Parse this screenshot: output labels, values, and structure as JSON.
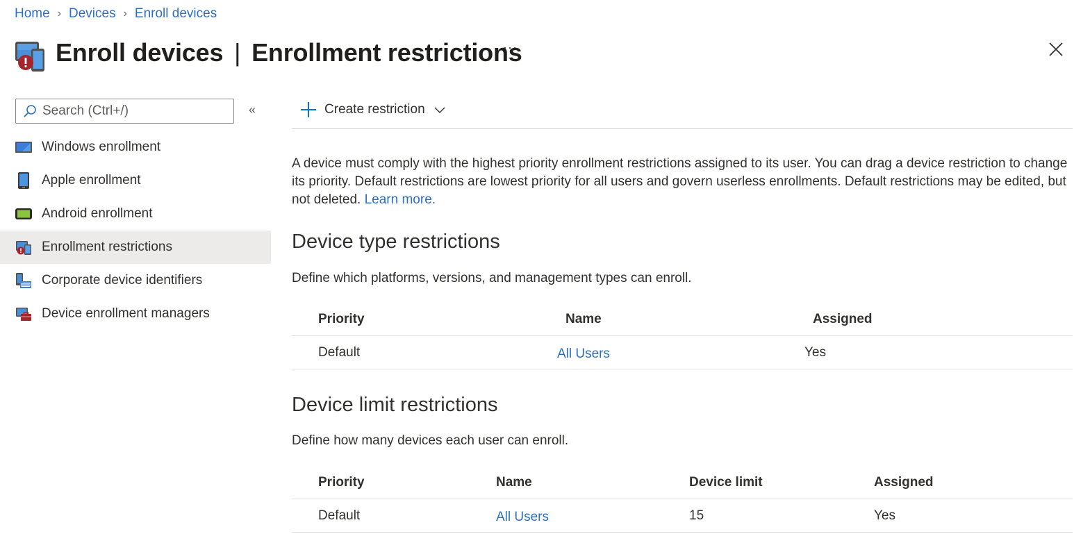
{
  "breadcrumb": [
    {
      "label": "Home"
    },
    {
      "label": "Devices"
    },
    {
      "label": "Enroll devices"
    }
  ],
  "header": {
    "title_main": "Enroll devices",
    "title_sep": "|",
    "title_sub": "Enrollment restrictions",
    "more_label": "···",
    "icon": "enrollment-restrictions-icon"
  },
  "sidebar": {
    "search_placeholder": "Search (Ctrl+/)",
    "collapse_label": "«",
    "items": [
      {
        "label": "Windows enrollment",
        "icon": "windows-device-icon",
        "active": false
      },
      {
        "label": "Apple enrollment",
        "icon": "apple-device-icon",
        "active": false
      },
      {
        "label": "Android enrollment",
        "icon": "android-device-icon",
        "active": false
      },
      {
        "label": "Enrollment restrictions",
        "icon": "restrictions-icon",
        "active": true
      },
      {
        "label": "Corporate device identifiers",
        "icon": "device-identifiers-icon",
        "active": false
      },
      {
        "label": "Device enrollment managers",
        "icon": "enrollment-managers-icon",
        "active": false
      }
    ]
  },
  "toolbar": {
    "create_label": "Create restriction"
  },
  "main": {
    "description": "A device must comply with the highest priority enrollment restrictions assigned to its user. You can drag a device restriction to change its priority. Default restrictions are lowest priority for all users and govern userless enrollments. Default restrictions may be edited, but not deleted.",
    "learn_more": "Learn more.",
    "device_type": {
      "title": "Device type restrictions",
      "subtitle": "Define which platforms, versions, and management types can enroll.",
      "columns": [
        "Priority",
        "Name",
        "Assigned"
      ],
      "rows": [
        {
          "priority": "Default",
          "name": "All Users",
          "assigned": "Yes"
        }
      ]
    },
    "device_limit": {
      "title": "Device limit restrictions",
      "subtitle": "Define how many devices each user can enroll.",
      "columns": [
        "Priority",
        "Name",
        "Device limit",
        "Assigned"
      ],
      "rows": [
        {
          "priority": "Default",
          "name": "All Users",
          "limit": "15",
          "assigned": "Yes"
        }
      ]
    }
  },
  "colors": {
    "link": "#2b6fc7",
    "active_nav_bg": "#edebe9",
    "accent_plus": "#0078d4",
    "alert_red": "#a4262c"
  }
}
